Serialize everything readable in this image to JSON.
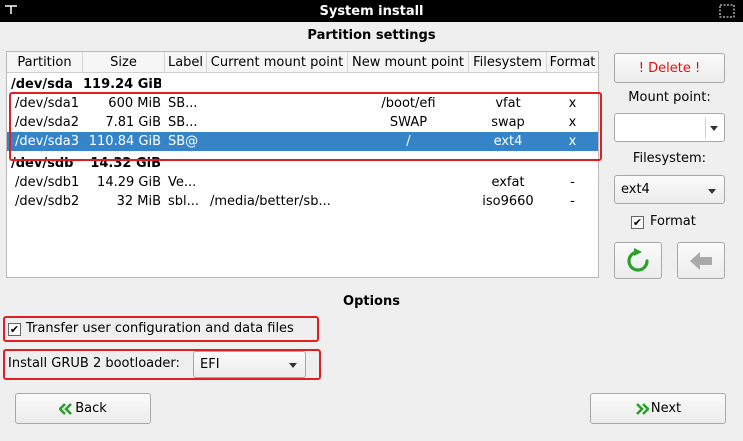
{
  "window": {
    "title": "System install"
  },
  "headings": {
    "partition_settings": "Partition settings",
    "options": "Options"
  },
  "table": {
    "columns": [
      "Partition",
      "Size",
      "Label",
      "Current mount point",
      "New mount point",
      "Filesystem",
      "Format"
    ],
    "rows": [
      {
        "partition": "/dev/sda",
        "size": "119.24 GiB",
        "label": "",
        "current_mount": "",
        "new_mount": "",
        "filesystem": "",
        "format": "",
        "is_disk": true
      },
      {
        "partition": "/dev/sda1",
        "size": "600 MiB",
        "label": "SB...",
        "current_mount": "",
        "new_mount": "/boot/efi",
        "filesystem": "vfat",
        "format": "x"
      },
      {
        "partition": "/dev/sda2",
        "size": "7.81 GiB",
        "label": "SB...",
        "current_mount": "",
        "new_mount": "SWAP",
        "filesystem": "swap",
        "format": "x"
      },
      {
        "partition": "/dev/sda3",
        "size": "110.84 GiB",
        "label": "SB@",
        "current_mount": "",
        "new_mount": "/",
        "filesystem": "ext4",
        "format": "x",
        "selected": true
      },
      {
        "partition": "/dev/sdb",
        "size": "14.32 GiB",
        "label": "",
        "current_mount": "",
        "new_mount": "",
        "filesystem": "",
        "format": "",
        "is_disk": true
      },
      {
        "partition": "/dev/sdb1",
        "size": "14.29 GiB",
        "label": "Ve...",
        "current_mount": "",
        "new_mount": "",
        "filesystem": "exfat",
        "format": "-"
      },
      {
        "partition": "/dev/sdb2",
        "size": "32 MiB",
        "label": "sbl...",
        "current_mount": "/media/better/sb...",
        "new_mount": "",
        "filesystem": "iso9660",
        "format": "-"
      }
    ]
  },
  "side_panel": {
    "delete_label": "! Delete !",
    "mount_point_label": "Mount point:",
    "mount_point_value": "",
    "filesystem_label": "Filesystem:",
    "filesystem_value": "ext4",
    "format_label": "Format",
    "format_checked": true
  },
  "options": {
    "transfer_label": "Transfer user configuration and data files",
    "transfer_checked": true,
    "grub_label": "Install GRUB 2 bootloader:",
    "grub_value": "EFI"
  },
  "nav": {
    "back_label": "Back",
    "next_label": "Next"
  },
  "colors": {
    "selection": "#3584c7",
    "highlight_box": "#e02020",
    "nav_arrow": "#2ca02c",
    "delete_text": "#e01010"
  }
}
